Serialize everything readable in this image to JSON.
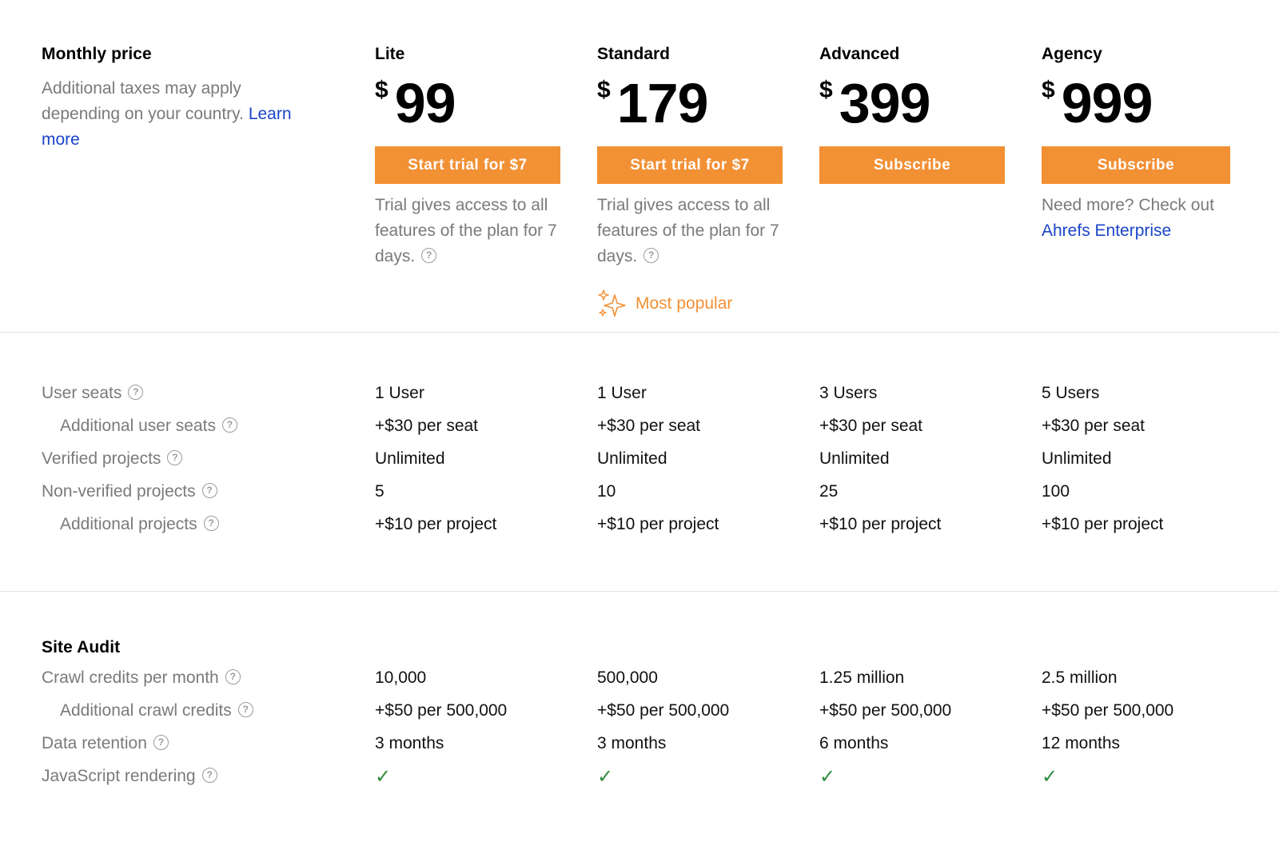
{
  "header": {
    "title": "Monthly price",
    "note_text": "Additional taxes may apply depending on your country.",
    "note_link": "Learn more"
  },
  "plans": [
    {
      "name": "Lite",
      "currency": "$",
      "price": "99",
      "cta": "Start trial for $7",
      "note": "Trial gives access to all features of the plan for 7 days."
    },
    {
      "name": "Standard",
      "currency": "$",
      "price": "179",
      "cta": "Start trial for $7",
      "note": "Trial gives access to all features of the plan for 7 days.",
      "badge": "Most popular"
    },
    {
      "name": "Advanced",
      "currency": "$",
      "price": "399",
      "cta": "Subscribe"
    },
    {
      "name": "Agency",
      "currency": "$",
      "price": "999",
      "cta": "Subscribe",
      "note": "Need more? Check out",
      "note_link": "Ahrefs Enterprise"
    }
  ],
  "users_section": {
    "rows": [
      {
        "label": "User seats",
        "indent": false,
        "values": [
          "1 User",
          "1 User",
          "3 Users",
          "5 Users"
        ]
      },
      {
        "label": "Additional user seats",
        "indent": true,
        "values": [
          "+$30 per seat",
          "+$30 per seat",
          "+$30 per seat",
          "+$30 per seat"
        ]
      },
      {
        "label": "Verified projects",
        "indent": false,
        "values": [
          "Unlimited",
          "Unlimited",
          "Unlimited",
          "Unlimited"
        ]
      },
      {
        "label": "Non-verified projects",
        "indent": false,
        "values": [
          "5",
          "10",
          "25",
          "100"
        ]
      },
      {
        "label": "Additional projects",
        "indent": true,
        "values": [
          "+$10 per project",
          "+$10 per project",
          "+$10 per project",
          "+$10 per project"
        ]
      }
    ]
  },
  "site_audit": {
    "title": "Site Audit",
    "rows": [
      {
        "label": "Crawl credits per month",
        "indent": false,
        "values": [
          "10,000",
          "500,000",
          "1.25 million",
          "2.5 million"
        ]
      },
      {
        "label": "Additional crawl credits",
        "indent": true,
        "values": [
          "+$50 per 500,000",
          "+$50 per 500,000",
          "+$50 per 500,000",
          "+$50 per 500,000"
        ]
      },
      {
        "label": "Data retention",
        "indent": false,
        "values": [
          "3 months",
          "3 months",
          "6 months",
          "12 months"
        ]
      },
      {
        "label": "JavaScript rendering",
        "indent": false,
        "values": [
          "✓",
          "✓",
          "✓",
          "✓"
        ]
      }
    ]
  },
  "icons": {
    "help": "?",
    "check": "✓"
  },
  "colors": {
    "accent": "#f29034",
    "link": "#1a44c8",
    "check": "#2e8b3d",
    "muted": "#7a7a7a"
  }
}
